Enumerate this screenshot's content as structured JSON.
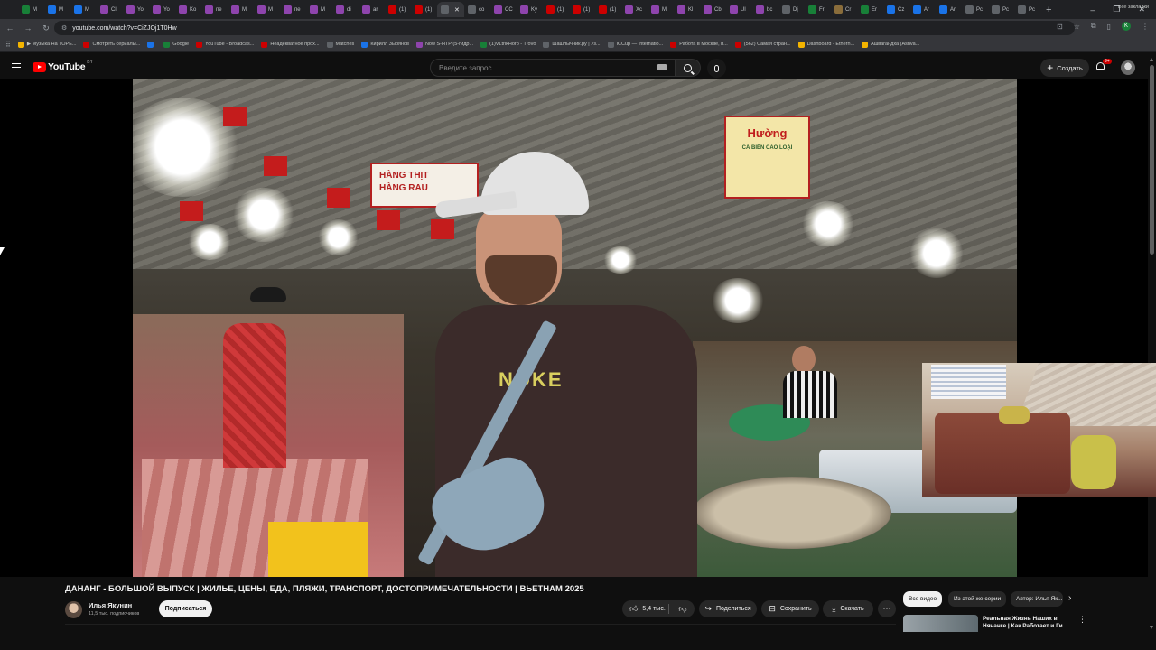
{
  "browser": {
    "tabs": [
      {
        "label": "M",
        "color": "#188038"
      },
      {
        "label": "M",
        "color": "#1a73e8"
      },
      {
        "label": "M",
        "color": "#1a73e8"
      },
      {
        "label": "Cl",
        "color": "#8e44ad"
      },
      {
        "label": "Yo",
        "color": "#8e44ad"
      },
      {
        "label": "Yo",
        "color": "#8e44ad"
      },
      {
        "label": "Ko",
        "color": "#8e44ad"
      },
      {
        "label": "пе",
        "color": "#8e44ad"
      },
      {
        "label": "M",
        "color": "#8e44ad"
      },
      {
        "label": "M",
        "color": "#8e44ad"
      },
      {
        "label": "пе",
        "color": "#8e44ad"
      },
      {
        "label": "M",
        "color": "#8e44ad"
      },
      {
        "label": "di",
        "color": "#8e44ad"
      },
      {
        "label": "ar",
        "color": "#8e44ad"
      },
      {
        "label": "(1)",
        "color": "#cc0000"
      },
      {
        "label": "(1)",
        "color": "#cc0000"
      },
      {
        "label": "",
        "color": "#5f6368",
        "active": true
      },
      {
        "label": "co",
        "color": "#5f6368"
      },
      {
        "label": "CC",
        "color": "#8e44ad"
      },
      {
        "label": "Ky",
        "color": "#8e44ad"
      },
      {
        "label": "(1)",
        "color": "#cc0000"
      },
      {
        "label": "(1)",
        "color": "#cc0000"
      },
      {
        "label": "(1)",
        "color": "#cc0000"
      },
      {
        "label": "Xc",
        "color": "#8e44ad"
      },
      {
        "label": "M",
        "color": "#8e44ad"
      },
      {
        "label": "Kl",
        "color": "#8e44ad"
      },
      {
        "label": "Cb",
        "color": "#8e44ad"
      },
      {
        "label": "Ul",
        "color": "#8e44ad"
      },
      {
        "label": "bc",
        "color": "#8e44ad"
      },
      {
        "label": "Dj",
        "color": "#5f6368"
      },
      {
        "label": "Fr",
        "color": "#188038"
      },
      {
        "label": "Cr",
        "color": "#8a6d3b"
      },
      {
        "label": "Er",
        "color": "#188038"
      },
      {
        "label": "Cz",
        "color": "#1a73e8"
      },
      {
        "label": "Ar",
        "color": "#1a73e8"
      },
      {
        "label": "Ar",
        "color": "#1a73e8"
      },
      {
        "label": "Pc",
        "color": "#5f6368"
      },
      {
        "label": "Pc",
        "color": "#5f6368"
      },
      {
        "label": "Pc",
        "color": "#5f6368"
      }
    ],
    "new_tab": "+",
    "window_controls": [
      "–",
      "❐",
      "✕"
    ],
    "url": "youtube.com/watch?v=CiZJOj1T0Hw",
    "profile_initial": "K",
    "bookmarks": [
      {
        "label": "▶ Музыка На ТОРЕ...",
        "color": "#f4b400"
      },
      {
        "label": "Смотреть сериалы...",
        "color": "#cc0000"
      },
      {
        "label": "",
        "color": "#1a73e8"
      },
      {
        "label": "Google",
        "color": "#188038"
      },
      {
        "label": "YouTube - Broadcas...",
        "color": "#cc0000"
      },
      {
        "label": "Неадекватное прох...",
        "color": "#cc0000"
      },
      {
        "label": "Matches",
        "color": "#5f6368"
      },
      {
        "label": "Кирилл Зырянов",
        "color": "#1a73e8"
      },
      {
        "label": "Now S-HTP (5-гидр...",
        "color": "#8e44ad"
      },
      {
        "label": "(1)VLtrikHoro - Trovo",
        "color": "#188038"
      },
      {
        "label": "Шашлычник.ру | Уз...",
        "color": "#5f6368"
      },
      {
        "label": "ICCup — Internatio...",
        "color": "#5f6368"
      },
      {
        "label": "Работа в Москве, п...",
        "color": "#cc0000"
      },
      {
        "label": "(562) Самая стран...",
        "color": "#cc0000"
      },
      {
        "label": "Dashboard - Ethern...",
        "color": "#f4b400"
      },
      {
        "label": "Ашвагандха (Ashva...",
        "color": "#f4b400"
      }
    ],
    "all_bookmarks": "Все закладки"
  },
  "youtube": {
    "logo_text": "YouTube",
    "logo_region": "BY",
    "search_placeholder": "Введите запрос",
    "create_label": "Создать",
    "notification_badge": "9+",
    "video_signs": {
      "left_sign": "HÀNG THỊT\nHÀNG RAU",
      "right_sign": "Hường",
      "right_sign_sub": "CÁ BIỂN CAO LOẠI",
      "shirt_print": "NOKE"
    },
    "video": {
      "title": "ДАНАНГ - БОЛЬШОЙ ВЫПУСК | ЖИЛЬЕ, ЦЕНЫ, ЕДА, ПЛЯЖИ, ТРАНСПОРТ, ДОСТОПРИМЕЧАТЕЛЬНОСТИ | ВЬЕТНАМ 2025",
      "channel": "Илья Якунин",
      "subscribers": "11,5 тыс. подписчиков",
      "subscribe_label": "Подписаться",
      "likes": "5,4 тыс.",
      "share_label": "Поделиться",
      "save_label": "Сохранить",
      "download_label": "Скачать"
    },
    "chips": {
      "all": "Все видео",
      "series": "Из этой же серии",
      "author": "Автор: Илья Як..."
    },
    "recommendation": {
      "title": "Реальная Жизнь Наших в Нячанге | Как Работает и Ги..."
    }
  }
}
